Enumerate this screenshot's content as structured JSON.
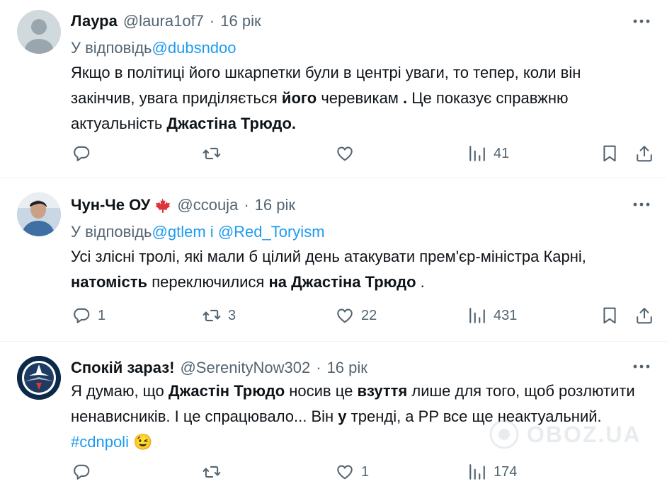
{
  "tweets": [
    {
      "name": "Лаура",
      "handle": "@laura1of7",
      "dot": "·",
      "time": "16 рік",
      "reply_prefix": "У відповідь",
      "reply_to": [
        "@dubsndoo"
      ],
      "text_segments": [
        {
          "t": "Якщо в політиці його шкарпетки були в центрі уваги, то тепер, коли він закінчив, увага приділяється ",
          "b": false
        },
        {
          "t": "його",
          "b": true
        },
        {
          "t": " черевикам ",
          "b": false
        },
        {
          "t": ".",
          "b": true
        },
        {
          "t": " Це показує справжню актуальність ",
          "b": false
        },
        {
          "t": "Джастіна Трюдо.",
          "b": true
        }
      ],
      "counts": {
        "reply": "",
        "retweet": "",
        "like": "",
        "views": "41"
      }
    },
    {
      "name": "Чун-Че ОУ",
      "handle": "@ccouja",
      "dot": "·",
      "time": "16 рік",
      "reply_prefix": "У відповідь",
      "reply_to": [
        "@gtlem",
        "і",
        "@Red_Toryism"
      ],
      "text_segments": [
        {
          "t": "Усі злісні тролі, які мали б цілий день атакувати прем'єр-міністра Карні, ",
          "b": false
        },
        {
          "t": "натомість",
          "b": true
        },
        {
          "t": " переключилися ",
          "b": false
        },
        {
          "t": "на Джастіна Трюдо",
          "b": true
        },
        {
          "t": " .",
          "b": false
        }
      ],
      "counts": {
        "reply": "1",
        "retweet": "3",
        "like": "22",
        "views": "431"
      }
    },
    {
      "name": "Спокій зараз!",
      "handle": "@SerenityNow302",
      "dot": "·",
      "time": "16 рік",
      "text_segments": [
        {
          "t": "Я думаю, що ",
          "b": false
        },
        {
          "t": "Джастін Трюдо",
          "b": true
        },
        {
          "t": " носив це ",
          "b": false
        },
        {
          "t": "взуття",
          "b": true
        },
        {
          "t": " лише для того, щоб розлютити ненависників. І це спрацювало... Він ",
          "b": false
        },
        {
          "t": "у",
          "b": true
        },
        {
          "t": " тренді, а PP все ще неактуальний. ",
          "b": false
        }
      ],
      "hashtag": "#cdnpoli",
      "emoji": "😉",
      "counts": {
        "reply": "",
        "retweet": "",
        "like": "1",
        "views": "174"
      }
    }
  ],
  "watermark": "OBOZ.UA",
  "icons": {
    "reply": "reply-icon",
    "retweet": "retweet-icon",
    "like": "heart-icon",
    "views": "views-icon",
    "bookmark": "bookmark-icon",
    "share": "share-icon",
    "more": "more-icon",
    "flag": "maple-leaf-icon"
  },
  "colors": {
    "text": "#0f1419",
    "muted": "#536471",
    "link": "#1d9bf0",
    "divider": "#eff3f4",
    "flag": "#e0343a"
  }
}
